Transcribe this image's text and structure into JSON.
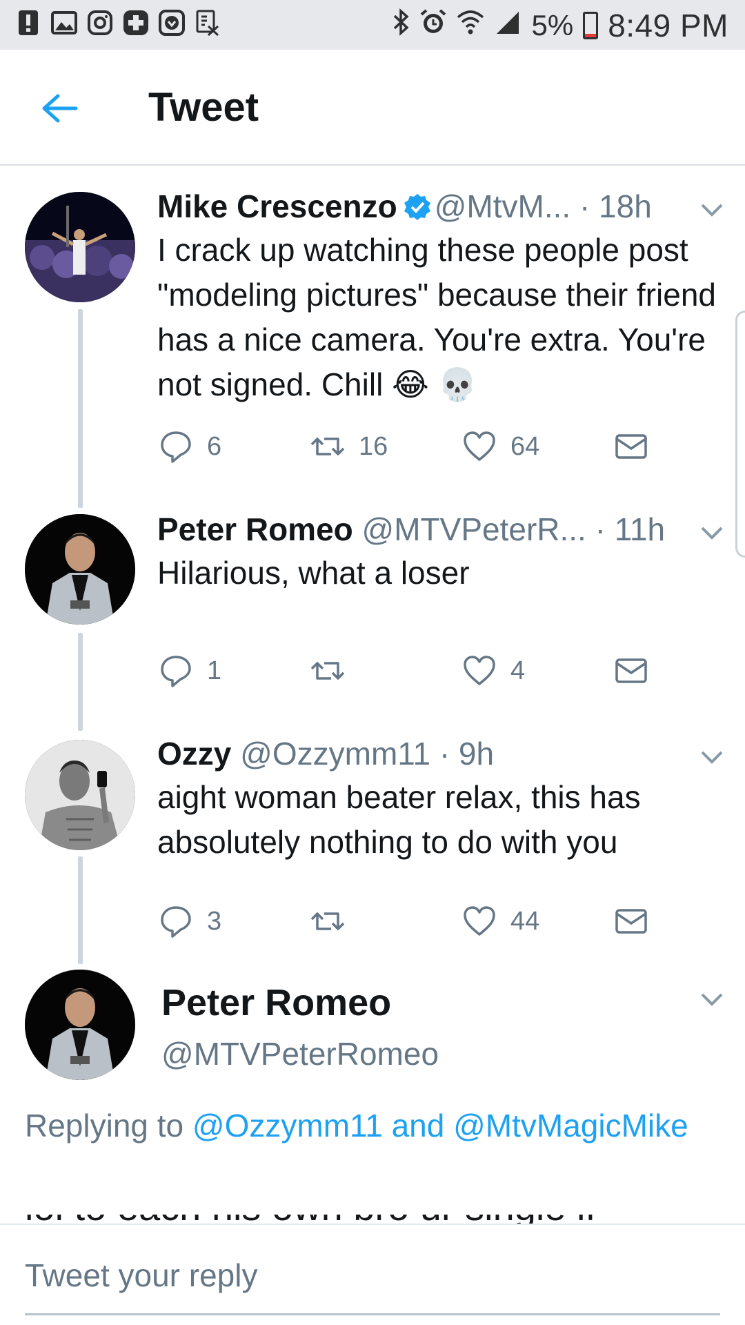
{
  "status_bar": {
    "battery_percent": "5%",
    "time": "8:49 PM"
  },
  "header": {
    "title": "Tweet"
  },
  "tweets": [
    {
      "name": "Mike Crescenzo",
      "verified": true,
      "handle": "@MtvM...",
      "time": "· 18h",
      "text": "I crack up watching these people post \"modeling pictures\" because their friend has a nice camera. You're extra. You're not signed. Chill 😂 💀",
      "replies": "6",
      "retweets": "16",
      "likes": "64"
    },
    {
      "name": "Peter Romeo",
      "verified": false,
      "handle": "@MTVPeterR...",
      "time": "· 11h",
      "text": "Hilarious, what a loser",
      "replies": "1",
      "retweets": "",
      "likes": "4"
    },
    {
      "name": "Ozzy",
      "verified": false,
      "handle": "@Ozzymm11",
      "time": "· 9h",
      "text": "aight woman beater relax, this has absolutely nothing to do with you",
      "replies": "3",
      "retweets": "",
      "likes": "44"
    }
  ],
  "focused_tweet": {
    "name": "Peter Romeo",
    "handle": "@MTVPeterRomeo",
    "replying_prefix": "Replying to",
    "replying_user_1": "@Ozzymm11",
    "replying_and": "and",
    "replying_user_2": "@MtvMagicMike",
    "cut_text": "lol to each his own bro ur single lf"
  },
  "reply_bar": {
    "placeholder": "Tweet your reply"
  },
  "colors": {
    "accent": "#1da1f2",
    "secondary_text": "#657786",
    "status_bar_bg": "#e6e8eb"
  }
}
